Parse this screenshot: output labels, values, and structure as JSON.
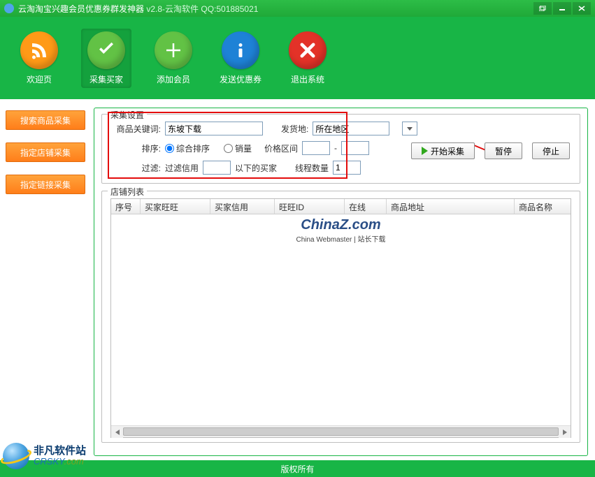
{
  "title_prefix": "云淘淘宝兴趣会员优惠券群发神器 ",
  "title_version": "v2.8-云淘软件 QQ:501885021",
  "toolbar": [
    {
      "label": "欢迎页"
    },
    {
      "label": "采集买家"
    },
    {
      "label": "添加会员"
    },
    {
      "label": "发送优惠券"
    },
    {
      "label": "退出系统"
    }
  ],
  "sidebar": [
    {
      "label": "搜索商品采集"
    },
    {
      "label": "指定店铺采集"
    },
    {
      "label": "指定链接采集"
    }
  ],
  "settings": {
    "legend": "采集设置",
    "keyword_label": "商品关键词:",
    "keyword_value": "东坡下载",
    "ship_label": "发货地:",
    "ship_value": "所在地区",
    "sort_label": "排序:",
    "sort_opt1": "综合排序",
    "sort_opt2": "销量",
    "price_label": "价格区间",
    "price_sep": "-",
    "filter_label": "过滤:",
    "filter_credit_prefix": "过滤信用",
    "filter_credit_suffix": "以下的买家",
    "thread_label": "线程数量",
    "thread_value": "1"
  },
  "actions": {
    "start": "开始采集",
    "pause": "暂停",
    "stop": "停止"
  },
  "list": {
    "legend": "店铺列表",
    "columns": [
      "序号",
      "买家旺旺",
      "买家信用",
      "旺旺ID",
      "在线",
      "商品地址",
      "商品名称"
    ]
  },
  "watermark": {
    "line1a": "China",
    "line1b": "Z",
    "line1c": ".com",
    "line2": "China Webmaster | 站长下载"
  },
  "footer": "版权所有",
  "crsky": {
    "t1": "非凡软件站",
    "t2a": "CRSKY",
    "t2b": ".com"
  }
}
